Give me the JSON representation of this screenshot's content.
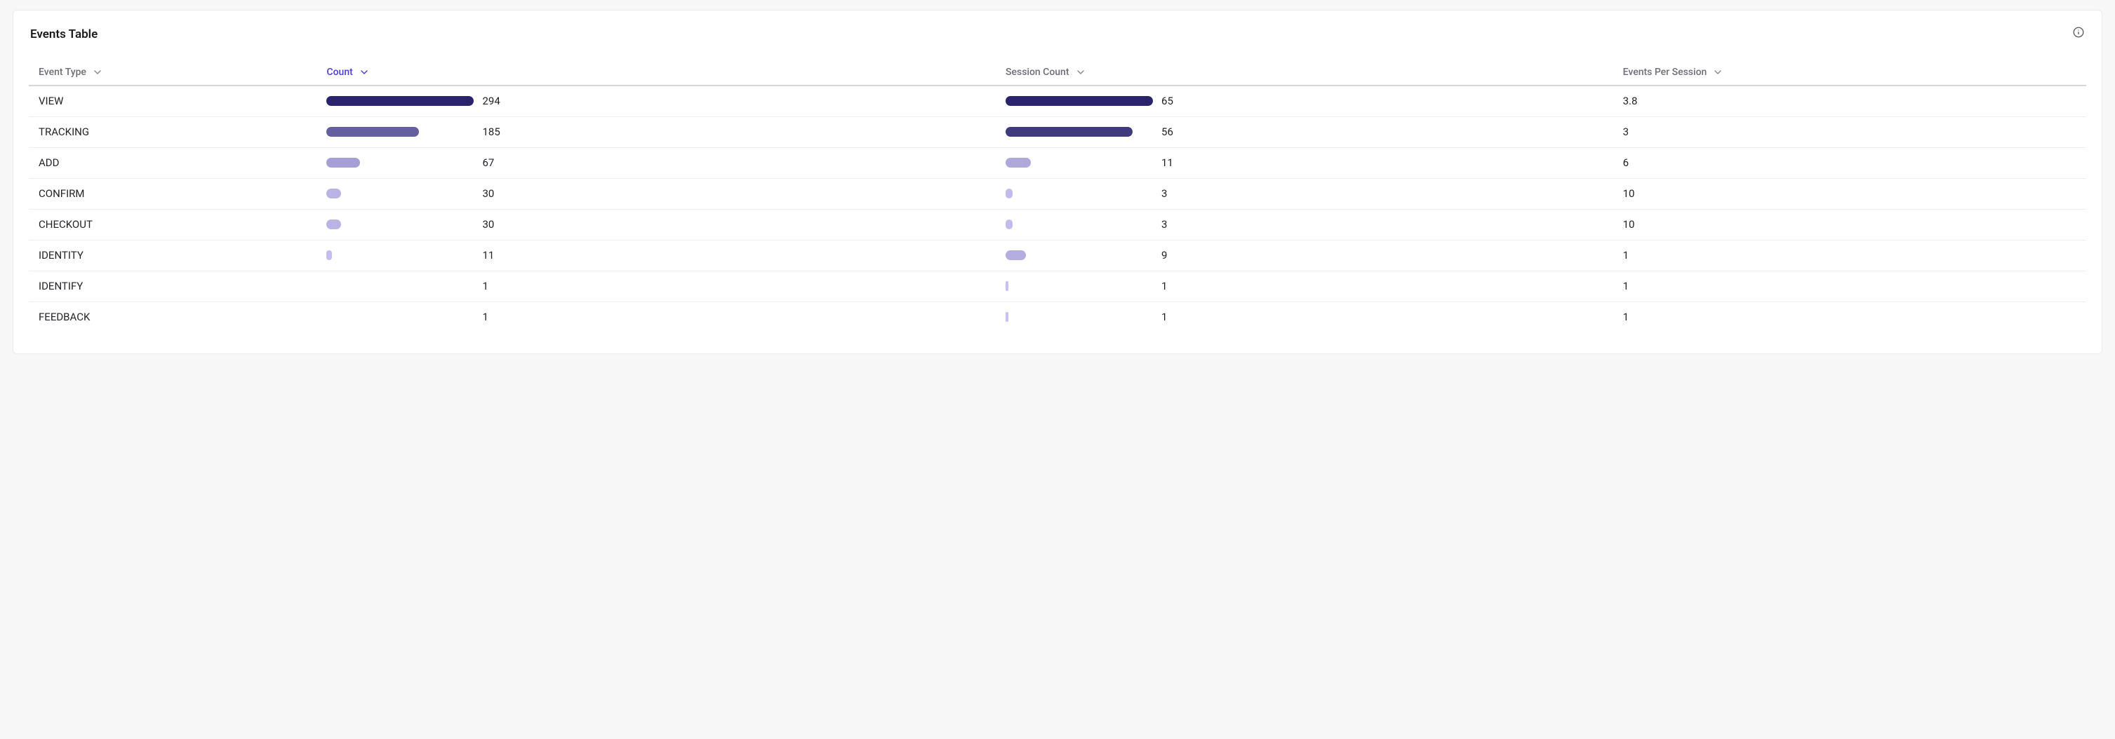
{
  "card": {
    "title": "Events Table"
  },
  "columns": {
    "event_type": "Event Type",
    "count": "Count",
    "session_count": "Session Count",
    "events_per_session": "Events Per Session"
  },
  "sorted_column": "count",
  "chart_data": {
    "type": "table",
    "title": "Events Table",
    "columns": [
      "Event Type",
      "Count",
      "Session Count",
      "Events Per Session"
    ],
    "series": [
      {
        "name": "Count",
        "max": 294
      },
      {
        "name": "Session Count",
        "max": 65
      }
    ],
    "rows": [
      {
        "event_type": "VIEW",
        "count": 294,
        "session_count": 65,
        "events_per_session": "3.8"
      },
      {
        "event_type": "TRACKING",
        "count": 185,
        "session_count": 56,
        "events_per_session": "3"
      },
      {
        "event_type": "ADD",
        "count": 67,
        "session_count": 11,
        "events_per_session": "6"
      },
      {
        "event_type": "CONFIRM",
        "count": 30,
        "session_count": 3,
        "events_per_session": "10"
      },
      {
        "event_type": "CHECKOUT",
        "count": 30,
        "session_count": 3,
        "events_per_session": "10"
      },
      {
        "event_type": "IDENTITY",
        "count": 11,
        "session_count": 9,
        "events_per_session": "1"
      },
      {
        "event_type": "IDENTIFY",
        "count": 1,
        "session_count": 1,
        "events_per_session": "1"
      },
      {
        "event_type": "FEEDBACK",
        "count": 1,
        "session_count": 1,
        "events_per_session": "1"
      }
    ]
  }
}
